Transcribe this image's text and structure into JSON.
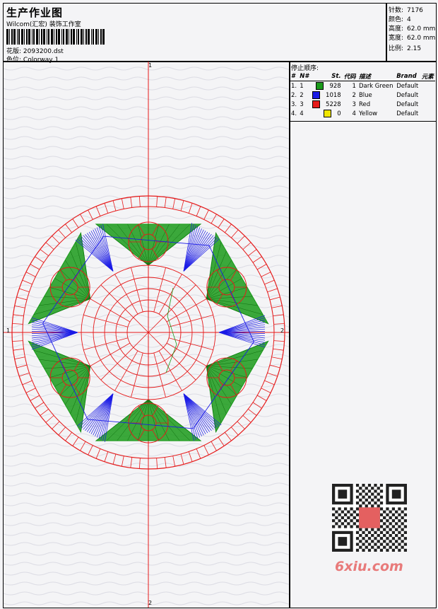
{
  "header": {
    "title": "生产作业图",
    "company": "Wilcom(汇宏) 装饰工作室",
    "design_label": "花版:",
    "design_file": "2093200.dst",
    "colorway_label": "色位:",
    "colorway": "Colorway 1"
  },
  "stats": [
    {
      "label": "针数:",
      "value": "7176"
    },
    {
      "label": "颜色:",
      "value": "4"
    },
    {
      "label": "高度:",
      "value": "62.0 mm"
    },
    {
      "label": "宽度:",
      "value": "62.0 mm"
    },
    {
      "label": "比例:",
      "value": "2.15"
    }
  ],
  "panel": {
    "heading": "停止顺序:",
    "columns": [
      "#",
      "N#",
      "St.",
      "代码",
      "描述",
      "Brand",
      "元素"
    ],
    "rows": [
      {
        "idx": "1.",
        "n": "1",
        "color": "#1a9a1a",
        "stitches": "928",
        "code": "1",
        "desc": "Dark Green",
        "brand": "Default"
      },
      {
        "idx": "2.",
        "n": "2",
        "color": "#1a1ae6",
        "stitches": "1018",
        "code": "2",
        "desc": "Blue",
        "brand": "Default"
      },
      {
        "idx": "3.",
        "n": "3",
        "color": "#e61a1a",
        "stitches": "5228",
        "code": "3",
        "desc": "Red",
        "brand": "Default"
      },
      {
        "idx": "4.",
        "n": "4",
        "color": "#f0e600",
        "stitches": "0",
        "code": "4",
        "desc": "Yellow",
        "brand": "Default"
      }
    ]
  },
  "axis_labels": {
    "top": "1",
    "bottom": "2",
    "right": "2",
    "left": "1"
  },
  "watermark": "6xiu.com",
  "colors": {
    "red": "#e61a1a",
    "green": "#1a9a1a",
    "blue": "#1a1ae6"
  }
}
